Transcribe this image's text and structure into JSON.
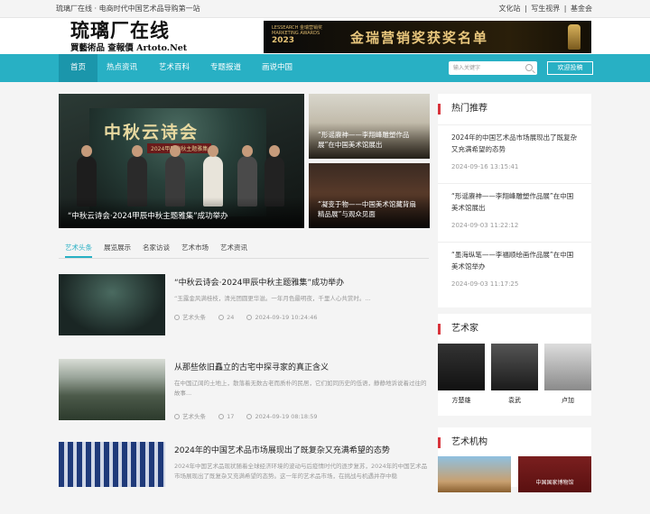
{
  "topbar": {
    "tagline": "琉璃厂在线 · 电商时代中国艺术品导购第一站",
    "links": [
      "文化站",
      "写生视界",
      "基金会"
    ]
  },
  "logo": {
    "title": "琉璃厂在线",
    "subtitle": "買藝術品 查報價  Artoto.Net"
  },
  "banner": {
    "small_line1": "LESSEARCH 金瑞营销奖",
    "small_line2": "MARKETING AWARDS",
    "year": "2023",
    "text": "金瑞营销奖获奖名单"
  },
  "nav": {
    "items": [
      "首页",
      "热点资讯",
      "艺术百科",
      "专题报道",
      "画说中国"
    ],
    "search_placeholder": "输入关键字",
    "contribute": "欢迎投稿"
  },
  "hero": {
    "main": {
      "caption": "“中秋云诗会·2024甲辰中秋主题雅集”成功举办",
      "stage_title": "中秋云诗会",
      "stage_sub": "2024甲辰中秋主题雅集"
    },
    "side": [
      {
        "caption": "“形谣赓神——李翔峰雕塑作品展”在中国美术馆展出"
      },
      {
        "caption": "“凝变于物——中国美术馆藏背扇精品展”与观众见面"
      }
    ]
  },
  "tabs": [
    "艺术头条",
    "展览展示",
    "名家访谈",
    "艺术市场",
    "艺术资讯"
  ],
  "articles": [
    {
      "title": "“中秋云诗会·2024甲辰中秋主题雅集”成功举办",
      "excerpt": "“玉露金风满桂枝，清光团圆更华滋。一年月色最明夜，千里人心共赏时。...",
      "category": "艺术头条",
      "views": "24",
      "date": "2024-09-19 10:24:46"
    },
    {
      "title": "从那些依旧矗立的古宅中探寻家的真正含义",
      "excerpt": "在中国辽阔的土地上，散落着无数古老而质朴的民居，它们如同历史的低语，静静地诉说着过往的故事...",
      "category": "艺术头条",
      "views": "17",
      "date": "2024-09-19 08:18:59"
    },
    {
      "title": "2024年的中国艺术品市场展现出了既复杂又充满希望的态势",
      "excerpt": "2024年中国艺术品现状随着全球经济环境的波动与后疫情时代的逐步复苏，2024年的中国艺术品市场展现出了既复杂又充满希望的态势。这一年的艺术品市场，在挑战与机遇并存中稳",
      "category": "",
      "views": "",
      "date": ""
    }
  ],
  "sidebar": {
    "hot_title": "热门推荐",
    "hot": [
      {
        "title": "2024年的中国艺术品市场展现出了既复杂又充满希望的态势",
        "date": "2024-09-16 13:15:41"
      },
      {
        "title": "“形谣赓神——李翔峰雕塑作品展”在中国美术馆展出",
        "date": "2024-09-03 11:22:12"
      },
      {
        "title": "“墨海纵笔——李福顺绘画作品展”在中国美术馆举办",
        "date": "2024-09-03 11:17:25"
      }
    ],
    "artists_title": "艺术家",
    "artists": [
      "方楚雄",
      "袁武",
      "卢加"
    ],
    "org_title": "艺术机构",
    "orgs": [
      "",
      "中国国家博物馆"
    ]
  },
  "colors": {
    "accent": "#28b0c4",
    "red_marker": "#d8343c"
  }
}
